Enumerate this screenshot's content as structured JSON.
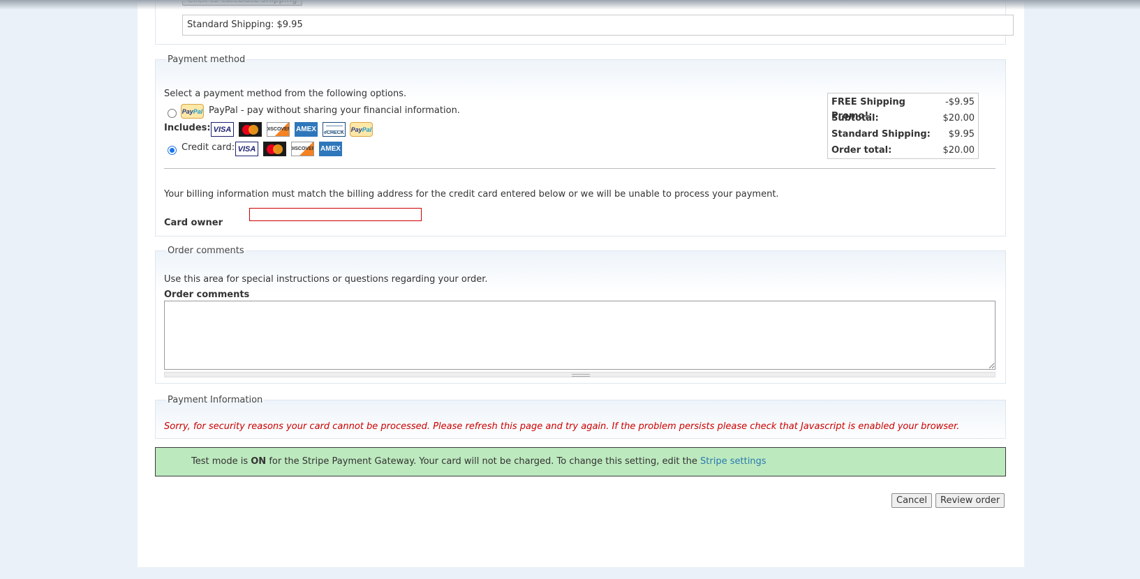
{
  "shipping": {
    "calc_button": "Click to calculate shipping",
    "selected": "Standard Shipping: $9.95"
  },
  "payment_method": {
    "legend": "Payment method",
    "instruction": "Select a payment method from the following options.",
    "paypal_text": "PayPal - pay without sharing your financial information.",
    "includes_label": "Includes:",
    "credit_card_label": "Credit card:",
    "logo_text": {
      "visa": "VISA",
      "discover": "DISCOVER",
      "amex": "AMEX",
      "echeck": "eCHECK",
      "paypal_a": "Pay",
      "paypal_b": "Pal"
    },
    "totals": [
      {
        "label": "FREE Shipping Promo!:",
        "value": "-$9.95"
      },
      {
        "label": "Subtotal:",
        "value": "$20.00"
      },
      {
        "label": "Standard Shipping:",
        "value": "$9.95"
      },
      {
        "label": "Order total:",
        "value": "$20.00"
      }
    ],
    "billing_notice": "Your billing information must match the billing address for the credit card entered below or we will be unable to process your payment.",
    "card_owner_label": "Card owner",
    "card_owner_value": ""
  },
  "order_comments": {
    "legend": "Order comments",
    "instruction": "Use this area for special instructions or questions regarding your order.",
    "field_label": "Order comments",
    "value": ""
  },
  "payment_info": {
    "legend": "Payment Information",
    "error": "Sorry, for security reasons your card cannot be processed. Please refresh this page and try again. If the problem persists please check that Javascript is enabled your browser."
  },
  "test_mode": {
    "prefix": "Test mode is ",
    "on": "ON",
    "middle": " for the Stripe Payment Gateway. Your card will not be charged. To change this setting, edit the ",
    "link": "Stripe settings"
  },
  "buttons": {
    "cancel": "Cancel",
    "review": "Review order"
  },
  "colors": {
    "page_bg": "#eaf1f8",
    "test_mode_bg": "#bde9be",
    "error_text": "#cc0000",
    "link": "#2a7ab0",
    "radio_accent": "#1a73e8"
  }
}
